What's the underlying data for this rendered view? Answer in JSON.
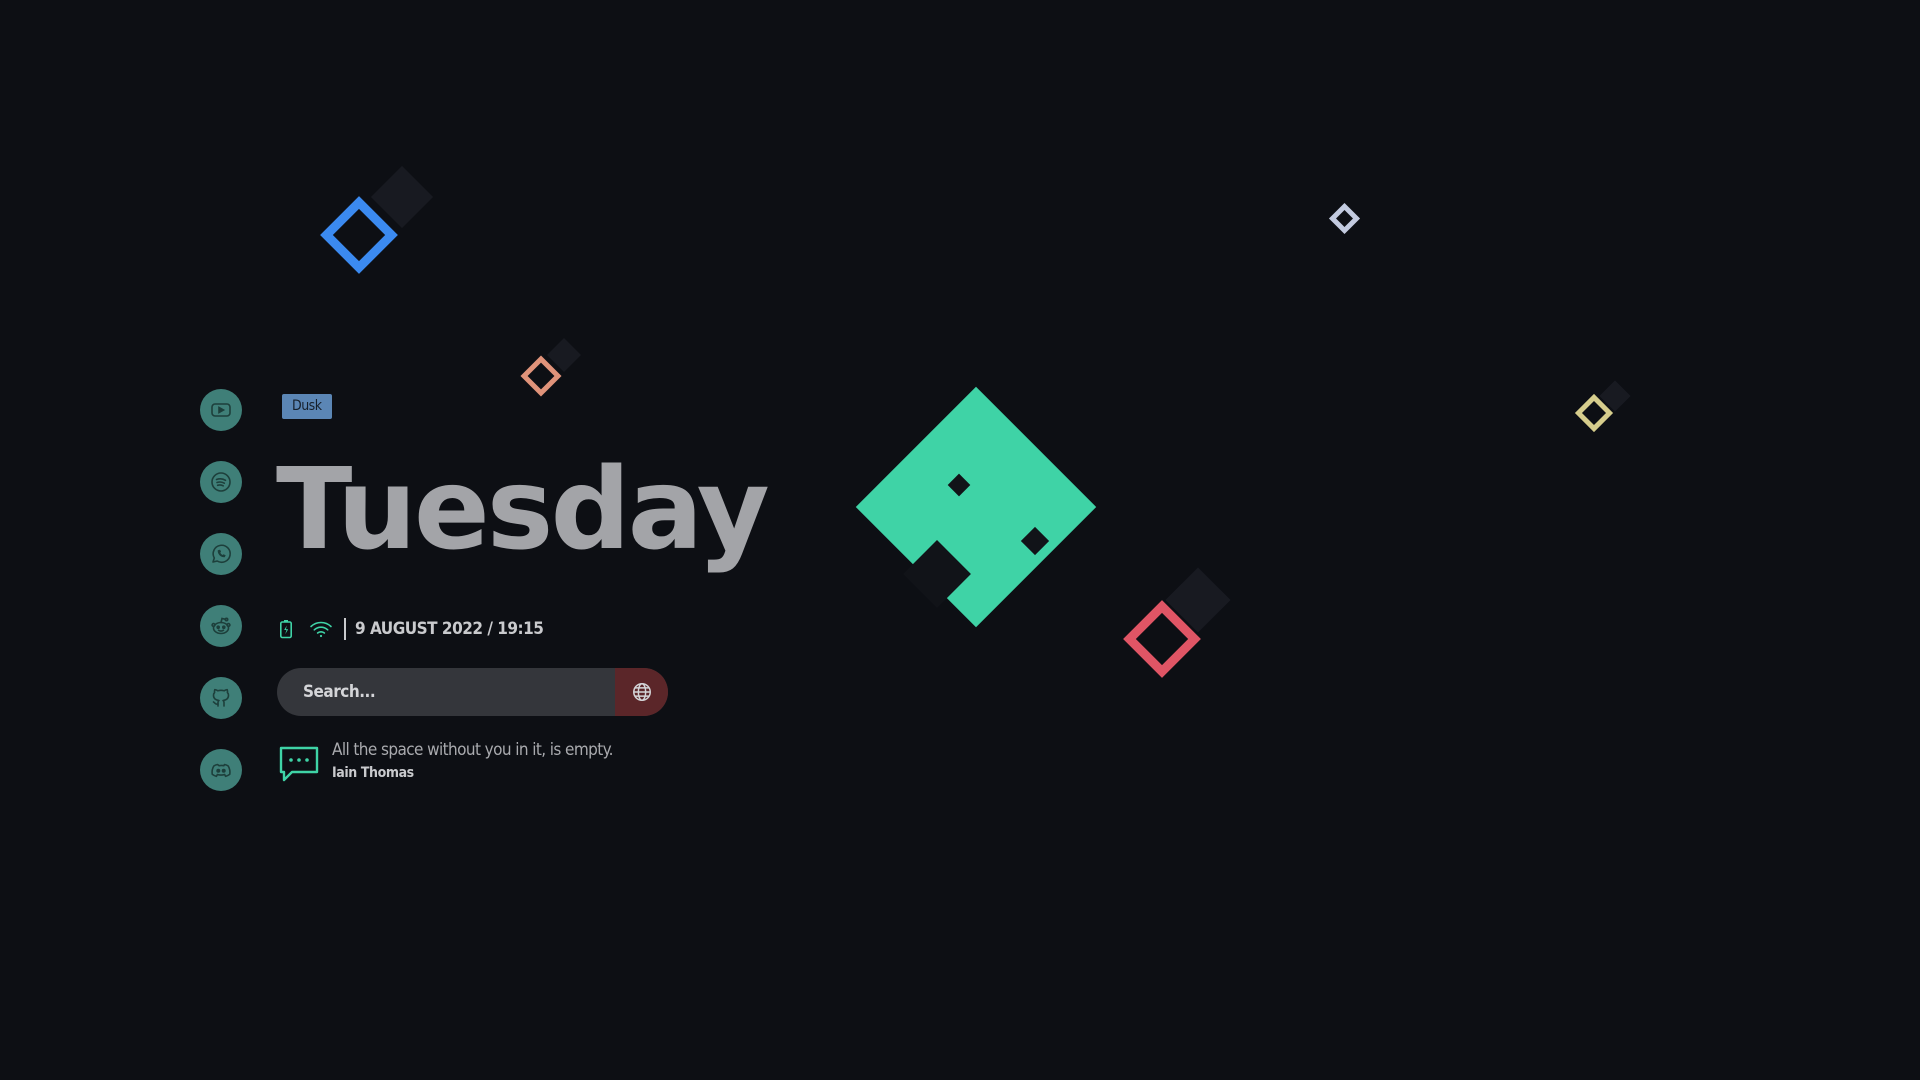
{
  "sidebar": {
    "items": [
      {
        "icon": "youtube-icon"
      },
      {
        "icon": "spotify-icon"
      },
      {
        "icon": "whatsapp-icon"
      },
      {
        "icon": "reddit-icon"
      },
      {
        "icon": "github-icon"
      },
      {
        "icon": "discord-icon"
      }
    ]
  },
  "tag": "Dusk",
  "day": "Tuesday",
  "status": {
    "battery_icon": "battery-icon",
    "wifi_icon": "wifi-icon",
    "datetime": "9 AUGUST 2022 / 19:15"
  },
  "search": {
    "placeholder": "Search...",
    "engine_icon": "globe-icon"
  },
  "quote": {
    "text": "All the space without you in it, is empty.",
    "author": "Iain Thomas"
  },
  "colors": {
    "background": "#0d0f14",
    "accent_teal": "#3fd3a6",
    "icon_circle": "#3f7f78",
    "blue": "#3b8af0",
    "red": "#e05565",
    "orange": "#e0937a",
    "yellow": "#d6cd8c",
    "tag": "#5b86b5",
    "search_button": "#5b2629"
  }
}
